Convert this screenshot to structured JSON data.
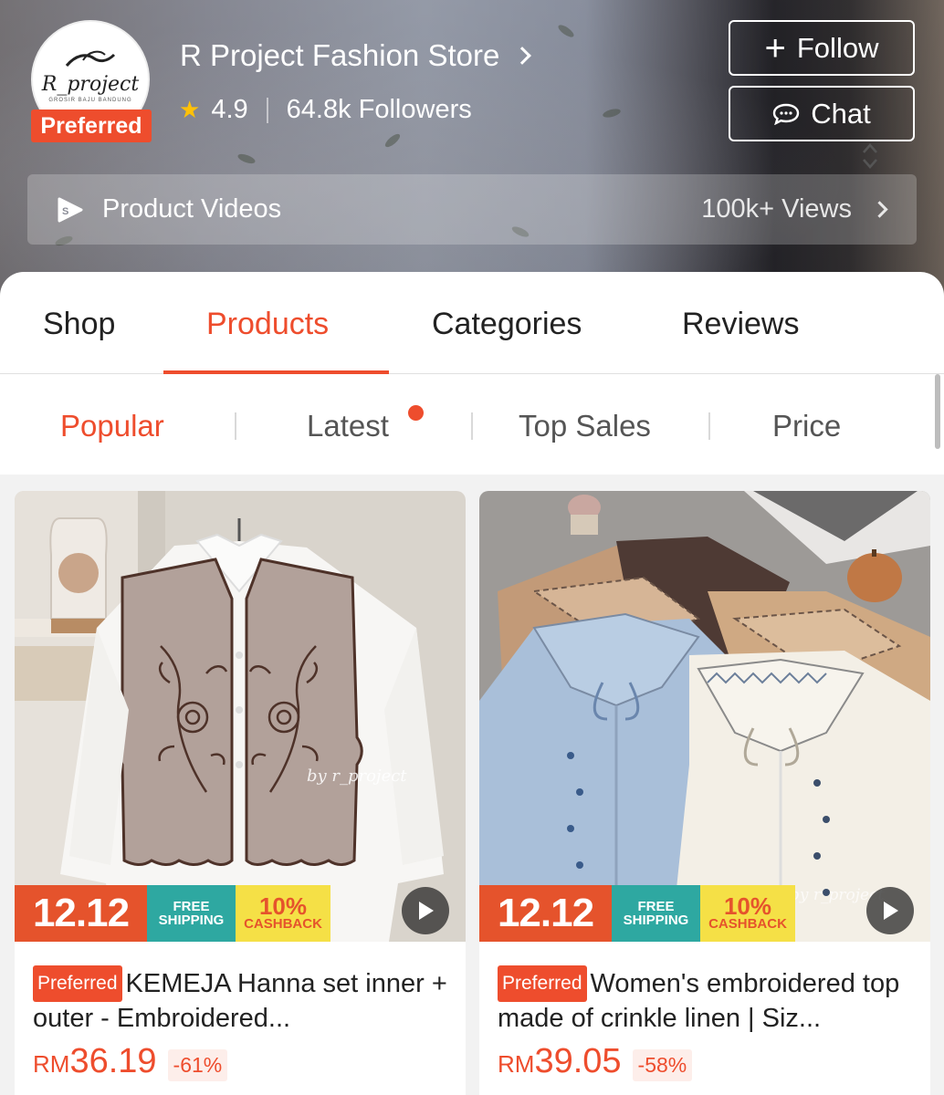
{
  "store": {
    "logo_text": "R_project",
    "logo_subtext": "GROSIR BAJU BANDUNG",
    "preferred_badge": "Preferred",
    "name": "R Project Fashion Store",
    "rating": "4.9",
    "followers": "64.8k Followers",
    "follow_label": "Follow",
    "chat_label": "Chat",
    "videos_label": "Product Videos",
    "videos_views": "100k+ Views"
  },
  "tabs": [
    {
      "label": "Shop",
      "active": false
    },
    {
      "label": "Products",
      "active": true
    },
    {
      "label": "Categories",
      "active": false
    },
    {
      "label": "Reviews",
      "active": false
    }
  ],
  "sort": [
    {
      "label": "Popular",
      "active": true
    },
    {
      "label": "Latest",
      "active": false,
      "has_dot": true
    },
    {
      "label": "Top Sales",
      "active": false
    },
    {
      "label": "Price",
      "active": false
    }
  ],
  "products": [
    {
      "badge": "Preferred",
      "title": "KEMEJA Hanna set inner + outer - Embroidered...",
      "currency": "RM",
      "price": "36.19",
      "discount": "-61%",
      "watermark": "by r_project",
      "promo": {
        "sale": "12.12",
        "ship_1": "FREE",
        "ship_2": "SHIPPING",
        "cash_big": "10%",
        "cash_small": "CASHBACK"
      }
    },
    {
      "badge": "Preferred",
      "title": "Women's embroidered top made of crinkle linen | Siz...",
      "currency": "RM",
      "price": "39.05",
      "discount": "-58%",
      "watermark": "by r_project",
      "promo": {
        "sale": "12.12",
        "ship_1": "FREE",
        "ship_2": "SHIPPING",
        "cash_big": "10%",
        "cash_small": "CASHBACK"
      }
    }
  ],
  "colors": {
    "accent": "#ee4d2d",
    "rating_star": "#ffc107",
    "free_shipping": "#2ea8a1",
    "cashback": "#f5e046"
  },
  "icons": [
    "chevron-right-icon",
    "star-icon",
    "plus-icon",
    "chat-icon",
    "shopee-video-icon",
    "sort-arrows-icon",
    "play-icon"
  ]
}
